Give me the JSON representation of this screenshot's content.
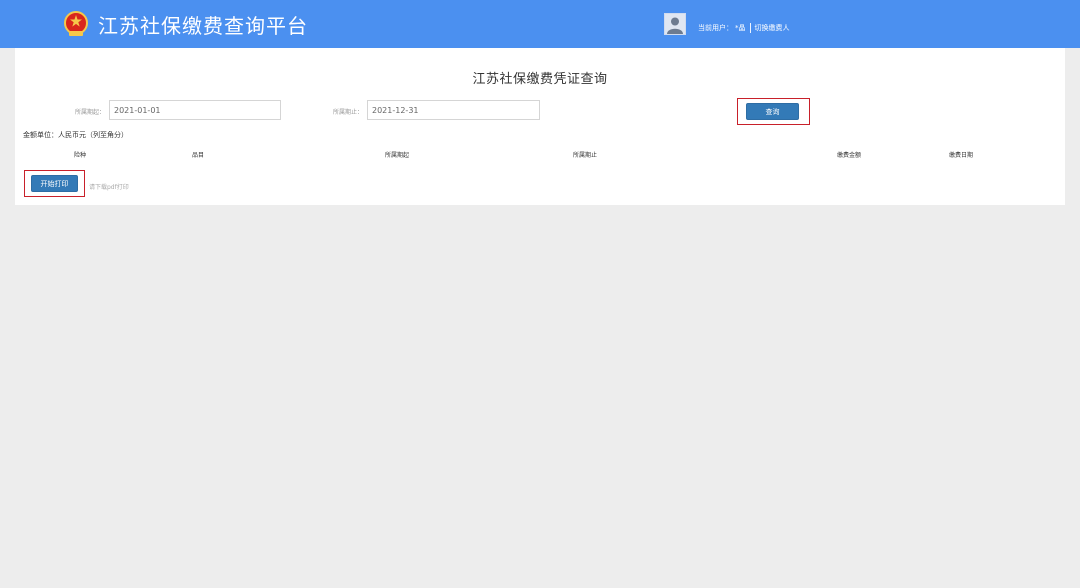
{
  "header": {
    "title": "江苏社保缴费查询平台",
    "emblem_icon": "national-emblem-icon",
    "avatar_icon": "user-avatar-icon",
    "current_user_label": "当前用户：",
    "current_user_name": "*晶",
    "switch_payer": "切换缴费人"
  },
  "main": {
    "title": "江苏社保缴费凭证查询",
    "filters": {
      "start_label": "所属期起：",
      "start_value": "2021-01-01",
      "end_label": "所属期止：",
      "end_value": "2021-12-31"
    },
    "query_button": "查询",
    "amount_unit": "金额单位：人民币元（列至角分）",
    "table": {
      "columns": [
        "险种",
        "品目",
        "所属期起",
        "所属期止",
        "缴费金额",
        "缴费日期"
      ]
    },
    "print_button": "开始打印",
    "print_hint": "请下载pdf打印"
  },
  "colors": {
    "header_bg": "#4b90f0",
    "button_bg": "#337ab7",
    "highlight_border": "#c8202a",
    "page_bg": "#ededed"
  }
}
